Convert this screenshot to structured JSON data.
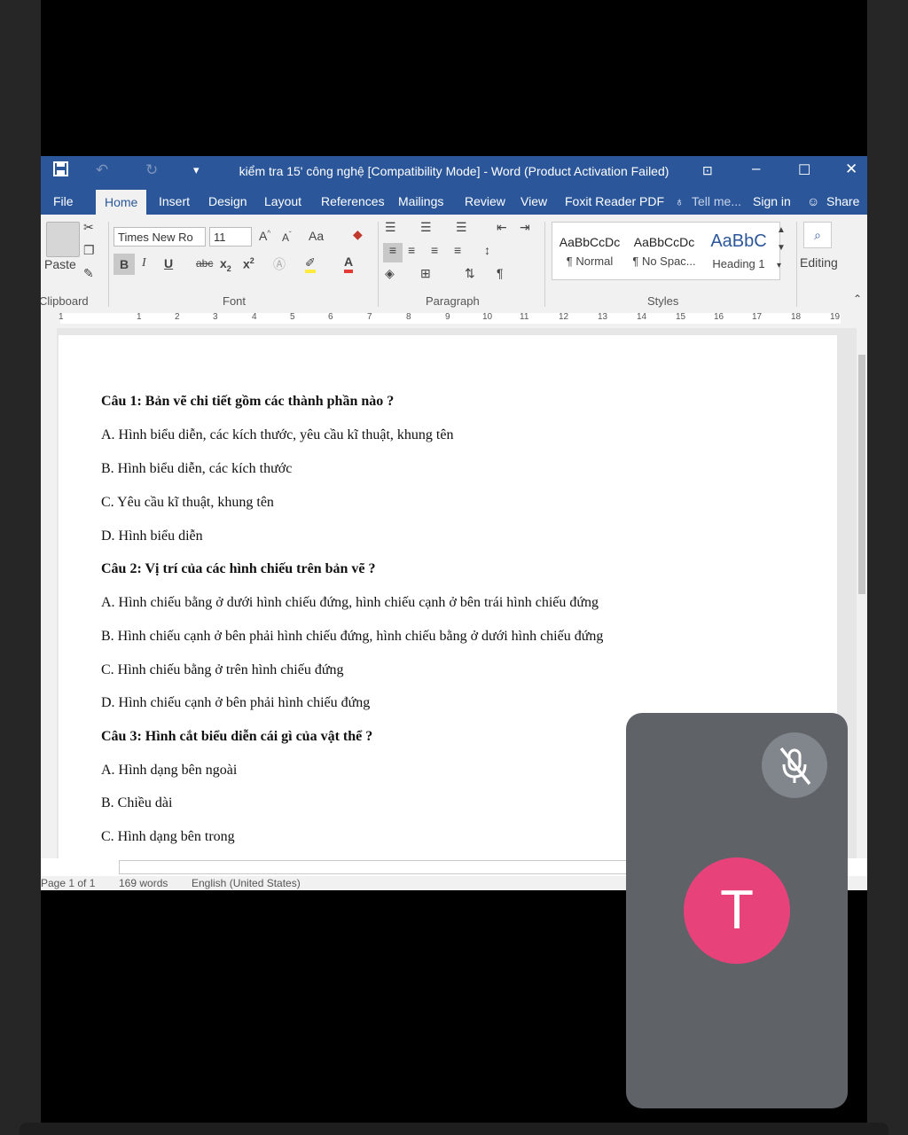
{
  "titlebar": {
    "title": "kiểm tra 15' công nghệ [Compatibility Mode] - Word (Product Activation Failed)"
  },
  "tabs": [
    "File",
    "Home",
    "Insert",
    "Design",
    "Layout",
    "References",
    "Mailings",
    "Review",
    "View",
    "Foxit Reader PDF"
  ],
  "tellme": "Tell me...",
  "signin": "Sign in",
  "share": "Share",
  "ribbon": {
    "paste": "Paste",
    "clipboard": "Clipboard",
    "font_name": "Times New Ro",
    "font_size": "11",
    "change_case": "Aa",
    "bold": "B",
    "italic": "I",
    "underline": "U",
    "strike": "abc",
    "font_group": "Font",
    "paragraph_group": "Paragraph",
    "styles_group": "Styles",
    "editing": "Editing",
    "styles": [
      {
        "preview": "AaBbCcDc",
        "name": "¶ Normal"
      },
      {
        "preview": "AaBbCcDc",
        "name": "¶ No Spac..."
      },
      {
        "preview": "AaBbC",
        "name": "Heading 1"
      }
    ]
  },
  "ruler": [
    "1",
    "1",
    "2",
    "3",
    "4",
    "5",
    "6",
    "7",
    "8",
    "9",
    "10",
    "11",
    "12",
    "13",
    "14",
    "15",
    "16",
    "17",
    "18",
    "19"
  ],
  "document": {
    "lines": [
      {
        "text": "Câu 1:  Bản vẽ chi tiết gồm các thành phần nào ?",
        "bold": true
      },
      {
        "text": "A. Hình biểu diễn, các kích thước, yêu cầu kĩ thuật, khung tên",
        "bold": false
      },
      {
        "text": "B. Hình biểu diễn, các kích thước",
        "bold": false
      },
      {
        "text": "C. Yêu cầu kĩ thuật, khung tên",
        "bold": false
      },
      {
        "text": "D. Hình biểu diễn",
        "bold": false
      },
      {
        "text": "Câu 2: Vị trí của các hình chiếu trên bản vẽ ?",
        "bold": true
      },
      {
        "text": "A. Hình chiếu bằng ở dưới hình chiếu đứng, hình chiếu cạnh ở bên trái hình chiếu đứng",
        "bold": false
      },
      {
        "text": "B. Hình chiếu cạnh ở bên phải hình chiếu đứng, hình chiếu bằng ở dưới hình chiếu đứng",
        "bold": false
      },
      {
        "text": "C. Hình chiếu bằng ở trên hình chiếu đứng",
        "bold": false
      },
      {
        "text": "D. Hình chiếu cạnh ở bên phải hình chiếu đứng",
        "bold": false
      },
      {
        "text": "Câu 3: Hình cắt biểu diễn cái gì của vật thể ?",
        "bold": true
      },
      {
        "text": "A. Hình dạng bên ngoài",
        "bold": false
      },
      {
        "text": "B. Chiều dài",
        "bold": false
      },
      {
        "text": "C. Hình dạng bên trong",
        "bold": false
      }
    ]
  },
  "status": {
    "page": "Page 1 of 1",
    "words": "169 words",
    "language": "English (United States)"
  },
  "participant": {
    "initial": "T",
    "avatar_color": "#e8427a",
    "muted": true
  }
}
